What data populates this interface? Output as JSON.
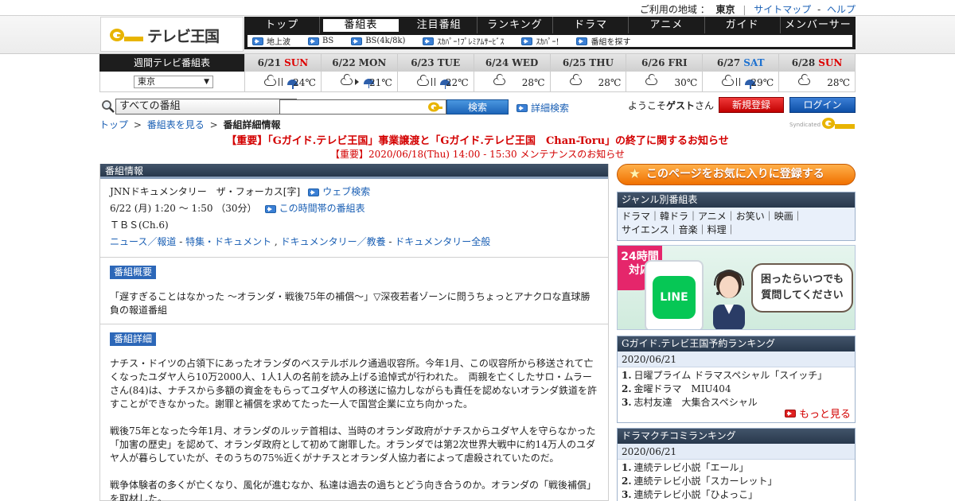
{
  "top": {
    "region_label": "ご利用の地域 ：",
    "region_value": "東京",
    "sitemap": "サイトマップ",
    "dash": "-",
    "help": "ヘルプ"
  },
  "logo": {
    "mark": "G GUIDE",
    "text": "テレビ王国"
  },
  "nav": {
    "tabs": [
      "トップ",
      "番組表",
      "注目番組",
      "ランキング",
      "ドラマ",
      "アニメ",
      "ガイド",
      "メンバーサービス"
    ],
    "active_index": 1,
    "sub": [
      "地上波",
      "BS",
      "BS(4k/8k)",
      "ｽｶﾊﾟｰ!ﾌﾟﾚﾐｱﾑｻｰﾋﾞｽ",
      "ｽｶﾊﾟｰ!",
      "番組を探す"
    ]
  },
  "weekly": {
    "label": "週間テレビ番組表",
    "region_select": "東京",
    "days": [
      {
        "date": "6/21",
        "dow": "SUN",
        "kind": "sun",
        "temp": "24℃",
        "wx": "cloud|rain"
      },
      {
        "date": "6/22",
        "dow": "MON",
        "kind": "",
        "temp": "21℃",
        "wx": "cloud>rain"
      },
      {
        "date": "6/23",
        "dow": "TUE",
        "kind": "",
        "temp": "22℃",
        "wx": "cloud|rain"
      },
      {
        "date": "6/24",
        "dow": "WED",
        "kind": "",
        "temp": "28℃",
        "wx": "cloud"
      },
      {
        "date": "6/25",
        "dow": "THU",
        "kind": "",
        "temp": "28℃",
        "wx": "cloud"
      },
      {
        "date": "6/26",
        "dow": "FRI",
        "kind": "",
        "temp": "30℃",
        "wx": "cloud"
      },
      {
        "date": "6/27",
        "dow": "SAT",
        "kind": "sat",
        "temp": "29℃",
        "wx": "cloud|rain"
      },
      {
        "date": "6/28",
        "dow": "SUN",
        "kind": "sun",
        "temp": "28℃",
        "wx": "cloud"
      }
    ]
  },
  "search": {
    "category": "すべての番組",
    "query": "",
    "button": "検索",
    "advanced": "詳細検索",
    "welcome_prefix": "ようこそ",
    "welcome_name": "ゲスト",
    "welcome_suffix": "さん",
    "register": "新規登録",
    "login": "ログイン"
  },
  "breadcrumb": {
    "items": [
      "トップ",
      "番組表を見る"
    ],
    "current": "番組詳細情報",
    "sep": ">"
  },
  "syndicated": {
    "label": "Syndicated",
    "mark": "G GUIDE"
  },
  "notices": {
    "line1": "【重要】「Gガイド.テレビ王国」事業譲渡と「Gガイド.テレビ王国　Chan-Toru」の終了に関するお知らせ",
    "line2": "【重要】2020/06/18(Thu) 14:00 - 15:30 メンテナンスのお知らせ"
  },
  "program": {
    "panel_title": "番組情報",
    "title": "JNNドキュメンタリー　ザ・フォーカス[字]",
    "web_search": "ウェブ検索",
    "time": "6/22 (月) 1:20 ～ 1:50 （30分）",
    "same_slot": "この時間帯の番組表",
    "channel": "ＴＢＳ(Ch.6)",
    "genres": [
      "ニュース／報道",
      "特集・ドキュメント",
      "ドキュメンタリー／教養",
      "ドキュメンタリー全般"
    ],
    "genre_sep1": " - ",
    "genre_sep2": " , ",
    "summary_badge": "番組概要",
    "summary": "「遅すぎることはなかった ～オランダ・戦後75年の補償～」▽深夜若者ゾーンに問うちょっとアナクロな直球勝負の報道番組",
    "detail_badge": "番組詳細",
    "detail_p1": "ナチス・ドイツの占領下にあったオランダのベステルボルク通過収容所。今年1月、この収容所から移送されて亡くなったユダヤ人ら10万2000人、1人1人の名前を読み上げる追悼式が行われた。　両親を亡くしたサロ・ムラーさん(84)は、ナチスから多額の資金をもらってユダヤ人の移送に協力しながらも責任を認めないオランダ鉄道を許すことができなかった。謝罪と補償を求めてたった一人で国営企業に立ち向かった。",
    "detail_p2": "戦後75年となった今年1月、オランダのルッテ首相は、当時のオランダ政府がナチスからユダヤ人を守らなかった「加害の歴史」を認めて、オランダ政府として初めて謝罪した。オランダでは第2次世界大戦中に約14万人のユダヤ人が暮らしていたが、そのうちの75%近くがナチスとオランダ人協力者によって虐殺されていたのだ。",
    "detail_p3": "戦争体験者の多くが亡くなり、風化が進むなか、私達は過去の過ちとどう向き合うのか。オランダの「戦後補償」を取材した。"
  },
  "right": {
    "favorite": "このページをお気に入りに登録する",
    "genre_title": "ジャンル別番組表",
    "genre_line1": "ドラマ｜韓ドラ｜アニメ｜お笑い｜映画｜",
    "genre_line2": "サイエンス｜音楽｜料理｜",
    "line_ad": {
      "badge": "24時間\n対応",
      "app": "LINE",
      "bubble": "困ったらいつでも\n質問してください"
    },
    "ranking1": {
      "title": "Gガイド.テレビ王国予約ランキング",
      "date": "2020/06/21",
      "items": [
        {
          "n": "1.",
          "t": "日曜プライム ドラマスペシャル「スイッチ」"
        },
        {
          "n": "2.",
          "t": "金曜ドラマ　MIU404"
        },
        {
          "n": "3.",
          "t": "志村友達　大集合スペシャル"
        }
      ],
      "more": "もっと見る"
    },
    "ranking2": {
      "title": "ドラマクチコミランキング",
      "date": "2020/06/21",
      "items": [
        {
          "n": "1.",
          "t": "連続テレビ小説「エール」"
        },
        {
          "n": "2.",
          "t": "連続テレビ小説「スカーレット」"
        },
        {
          "n": "3.",
          "t": "連続テレビ小説「ひよっこ」"
        }
      ]
    }
  },
  "colors": {
    "accent_blue": "#2c67b8",
    "alert_red": "#d30000",
    "nav_dark": "#1b1b1b"
  }
}
